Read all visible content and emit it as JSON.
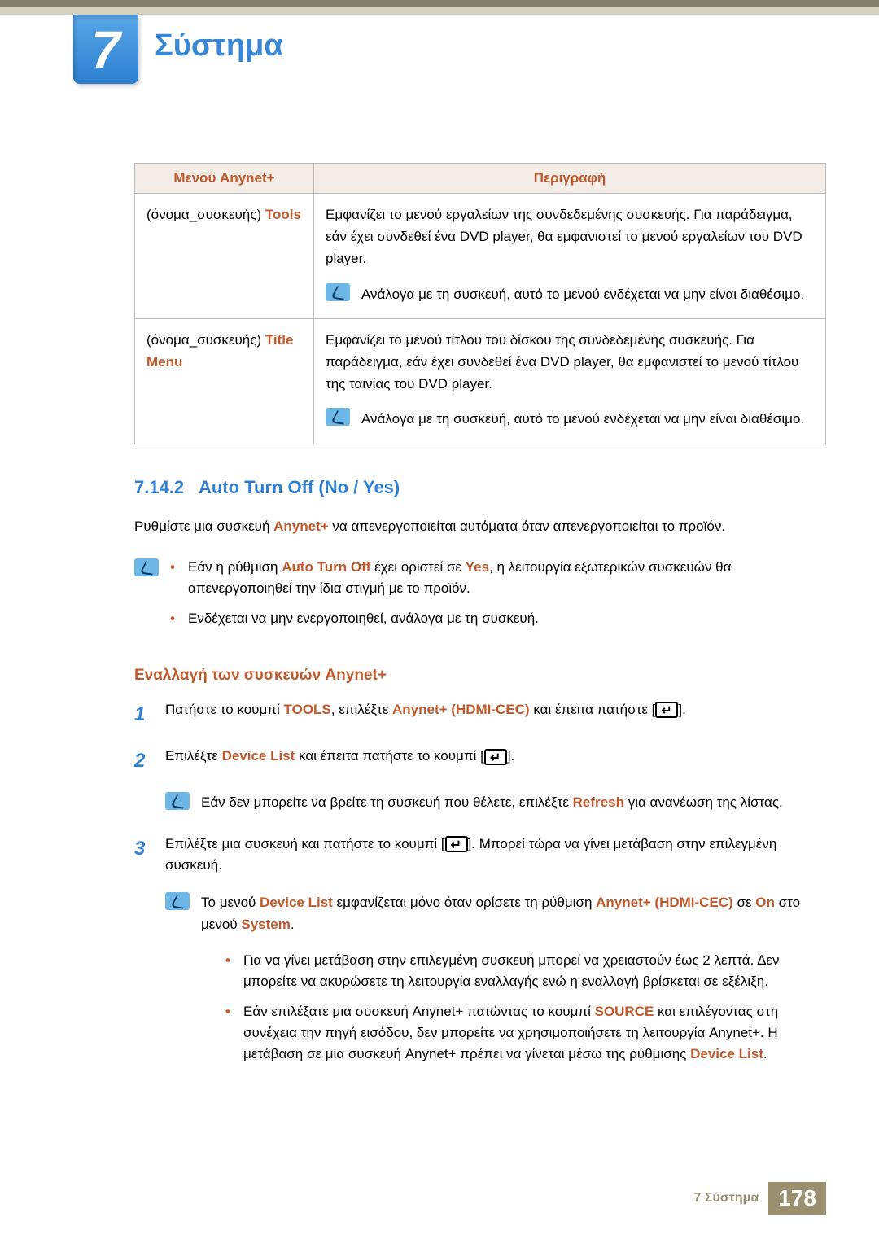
{
  "chapter": {
    "number": "7",
    "title": "Σύστημα"
  },
  "table": {
    "headers": {
      "col1": "Μενού Anynet+",
      "col2": "Περιγραφή"
    },
    "row1": {
      "prefix": "(όνομα_συσκευής) ",
      "label": "Tools",
      "desc": "Εμφανίζει το μενού εργαλείων της συνδεδεμένης συσκευής. Για παράδειγμα, εάν έχει συνδεθεί ένα DVD player, θα εμφανιστεί το μενού εργαλείων του DVD player.",
      "note": "Ανάλογα με τη συσκευή, αυτό το μενού ενδέχεται να μην είναι διαθέσιμο."
    },
    "row2": {
      "prefix": "(όνομα_συσκευής) ",
      "label": "Title Menu",
      "desc": "Εμφανίζει το μενού τίτλου του δίσκου της συνδεδεμένης συσκευής. Για παράδειγμα, εάν έχει συνδεθεί ένα DVD player, θα εμφανιστεί το μενού τίτλου της ταινίας του DVD player.",
      "note": "Ανάλογα με τη συσκευή, αυτό το μενού ενδέχεται να μην είναι διαθέσιμο."
    }
  },
  "section": {
    "number": "7.14.2",
    "title": "Auto Turn Off (No / Yes)",
    "intro_before": "Ρυθμίστε μια συσκευή ",
    "intro_hl": "Anynet+",
    "intro_after": " να απενεργοποιείται αυτόματα όταν απενεργοποιείται το προϊόν.",
    "note_bullets": {
      "b1_a": "Εάν η ρύθμιση ",
      "b1_hl1": "Auto Turn Off",
      "b1_b": " έχει οριστεί σε ",
      "b1_hl2": "Yes",
      "b1_c": ", η λειτουργία εξωτερικών συσκευών θα απενεργοποιηθεί την ίδια στιγμή με το προϊόν.",
      "b2": "Ενδέχεται να μην ενεργοποιηθεί, ανάλογα με τη συσκευή."
    },
    "subhead": "Εναλλαγή των συσκευών Anynet+",
    "step1": {
      "a": "Πατήστε το κουμπί ",
      "hl1": "TOOLS",
      "b": ", επιλέξτε ",
      "hl2": "Anynet+ (HDMI-CEC)",
      "c": " και έπειτα πατήστε [",
      "d": "]."
    },
    "step2": {
      "a": "Επιλέξτε ",
      "hl": "Device List",
      "b": " και έπειτα πατήστε το κουμπί [",
      "c": "]."
    },
    "step2_note": {
      "a": "Εάν δεν μπορείτε να βρείτε τη συσκευή που θέλετε, επιλέξτε ",
      "hl": "Refresh",
      "b": " για ανανέωση της λίστας."
    },
    "step3": {
      "a": "Επιλέξτε μια συσκευή και πατήστε το κουμπί [",
      "b": "]. Μπορεί τώρα να γίνει μετάβαση στην επιλεγμένη συσκευή."
    },
    "big_note": {
      "line_a": "Το μενού ",
      "hl1": "Device List",
      "line_b": " εμφανίζεται μόνο όταν ορίσετε τη ρύθμιση ",
      "hl2": "Anynet+ (HDMI-CEC)",
      "line_c": " σε ",
      "hl3": "On",
      "line_d": " στο μενού ",
      "hl4": "System",
      "line_e": ".",
      "bullet1": "Για να γίνει μετάβαση στην επιλεγμένη συσκευή μπορεί να χρειαστούν έως 2 λεπτά. Δεν μπορείτε να ακυρώσετε τη λειτουργία εναλλαγής ενώ η εναλλαγή βρίσκεται σε εξέλιξη.",
      "bullet2_a": "Εάν επιλέξατε μια συσκευή Anynet+ πατώντας το κουμπί ",
      "bullet2_hl1": "SOURCE",
      "bullet2_b": " και επιλέγοντας στη συνέχεια την πηγή εισόδου, δεν μπορείτε να χρησιμοποιήσετε τη λειτουργία Anynet+. Η μετάβαση σε μια συσκευή Anynet+ πρέπει να γίνεται μέσω της ρύθμισης ",
      "bullet2_hl2": "Device List",
      "bullet2_c": "."
    }
  },
  "footer": {
    "text": "7 Σύστημα",
    "page": "178"
  }
}
